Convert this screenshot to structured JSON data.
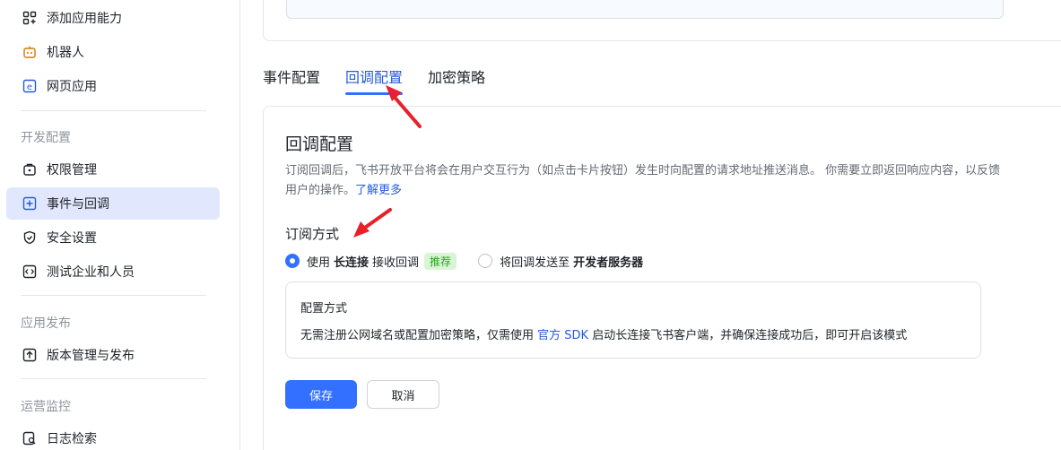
{
  "sidebar": {
    "items_top": [
      {
        "label": "添加应用能力",
        "icon": "add-apps-icon"
      },
      {
        "label": "机器人",
        "icon": "robot-icon"
      },
      {
        "label": "网页应用",
        "icon": "web-app-icon"
      }
    ],
    "groups": [
      {
        "label": "开发配置"
      },
      {
        "label": "应用发布"
      },
      {
        "label": "运营监控"
      }
    ],
    "dev_items": [
      {
        "label": "权限管理",
        "icon": "permission-icon"
      },
      {
        "label": "事件与回调",
        "icon": "event-callback-icon"
      },
      {
        "label": "安全设置",
        "icon": "shield-icon"
      },
      {
        "label": "测试企业和人员",
        "icon": "test-org-icon"
      }
    ],
    "release_items": [
      {
        "label": "版本管理与发布",
        "icon": "upload-icon"
      }
    ],
    "monitor_items": [
      {
        "label": "日志检索",
        "icon": "log-search-icon"
      }
    ]
  },
  "tabs": [
    {
      "label": "事件配置"
    },
    {
      "label": "回调配置"
    },
    {
      "label": "加密策略"
    }
  ],
  "card": {
    "title": "回调配置",
    "description": "订阅回调后，飞书开放平台将会在用户交互行为（如点击卡片按钮）发生时向配置的请求地址推送消息。 你需要立即返回响应内容，以反馈用户的操作。",
    "learn_more": "了解更多",
    "subscription_title": "订阅方式",
    "option1": {
      "prefix": "使用",
      "bold": "长连接",
      "suffix": "接收回调",
      "badge": "推荐"
    },
    "option2": {
      "prefix": "将回调发送至",
      "bold": "开发者服务器"
    },
    "config_box": {
      "title": "配置方式",
      "desc_before": "无需注册公网域名或配置加密策略，仅需使用",
      "desc_link": "官方 SDK",
      "desc_after": "启动长连接飞书客户端，并确保连接成功后，即可开启该模式"
    },
    "save_label": "保存",
    "cancel_label": "取消"
  },
  "colors": {
    "accent": "#3370ff",
    "active_nav_bg": "#e1e8fd",
    "badge_bg": "#d9f5d6",
    "badge_text": "#2ea121",
    "annotation_arrow": "#e8202a"
  }
}
